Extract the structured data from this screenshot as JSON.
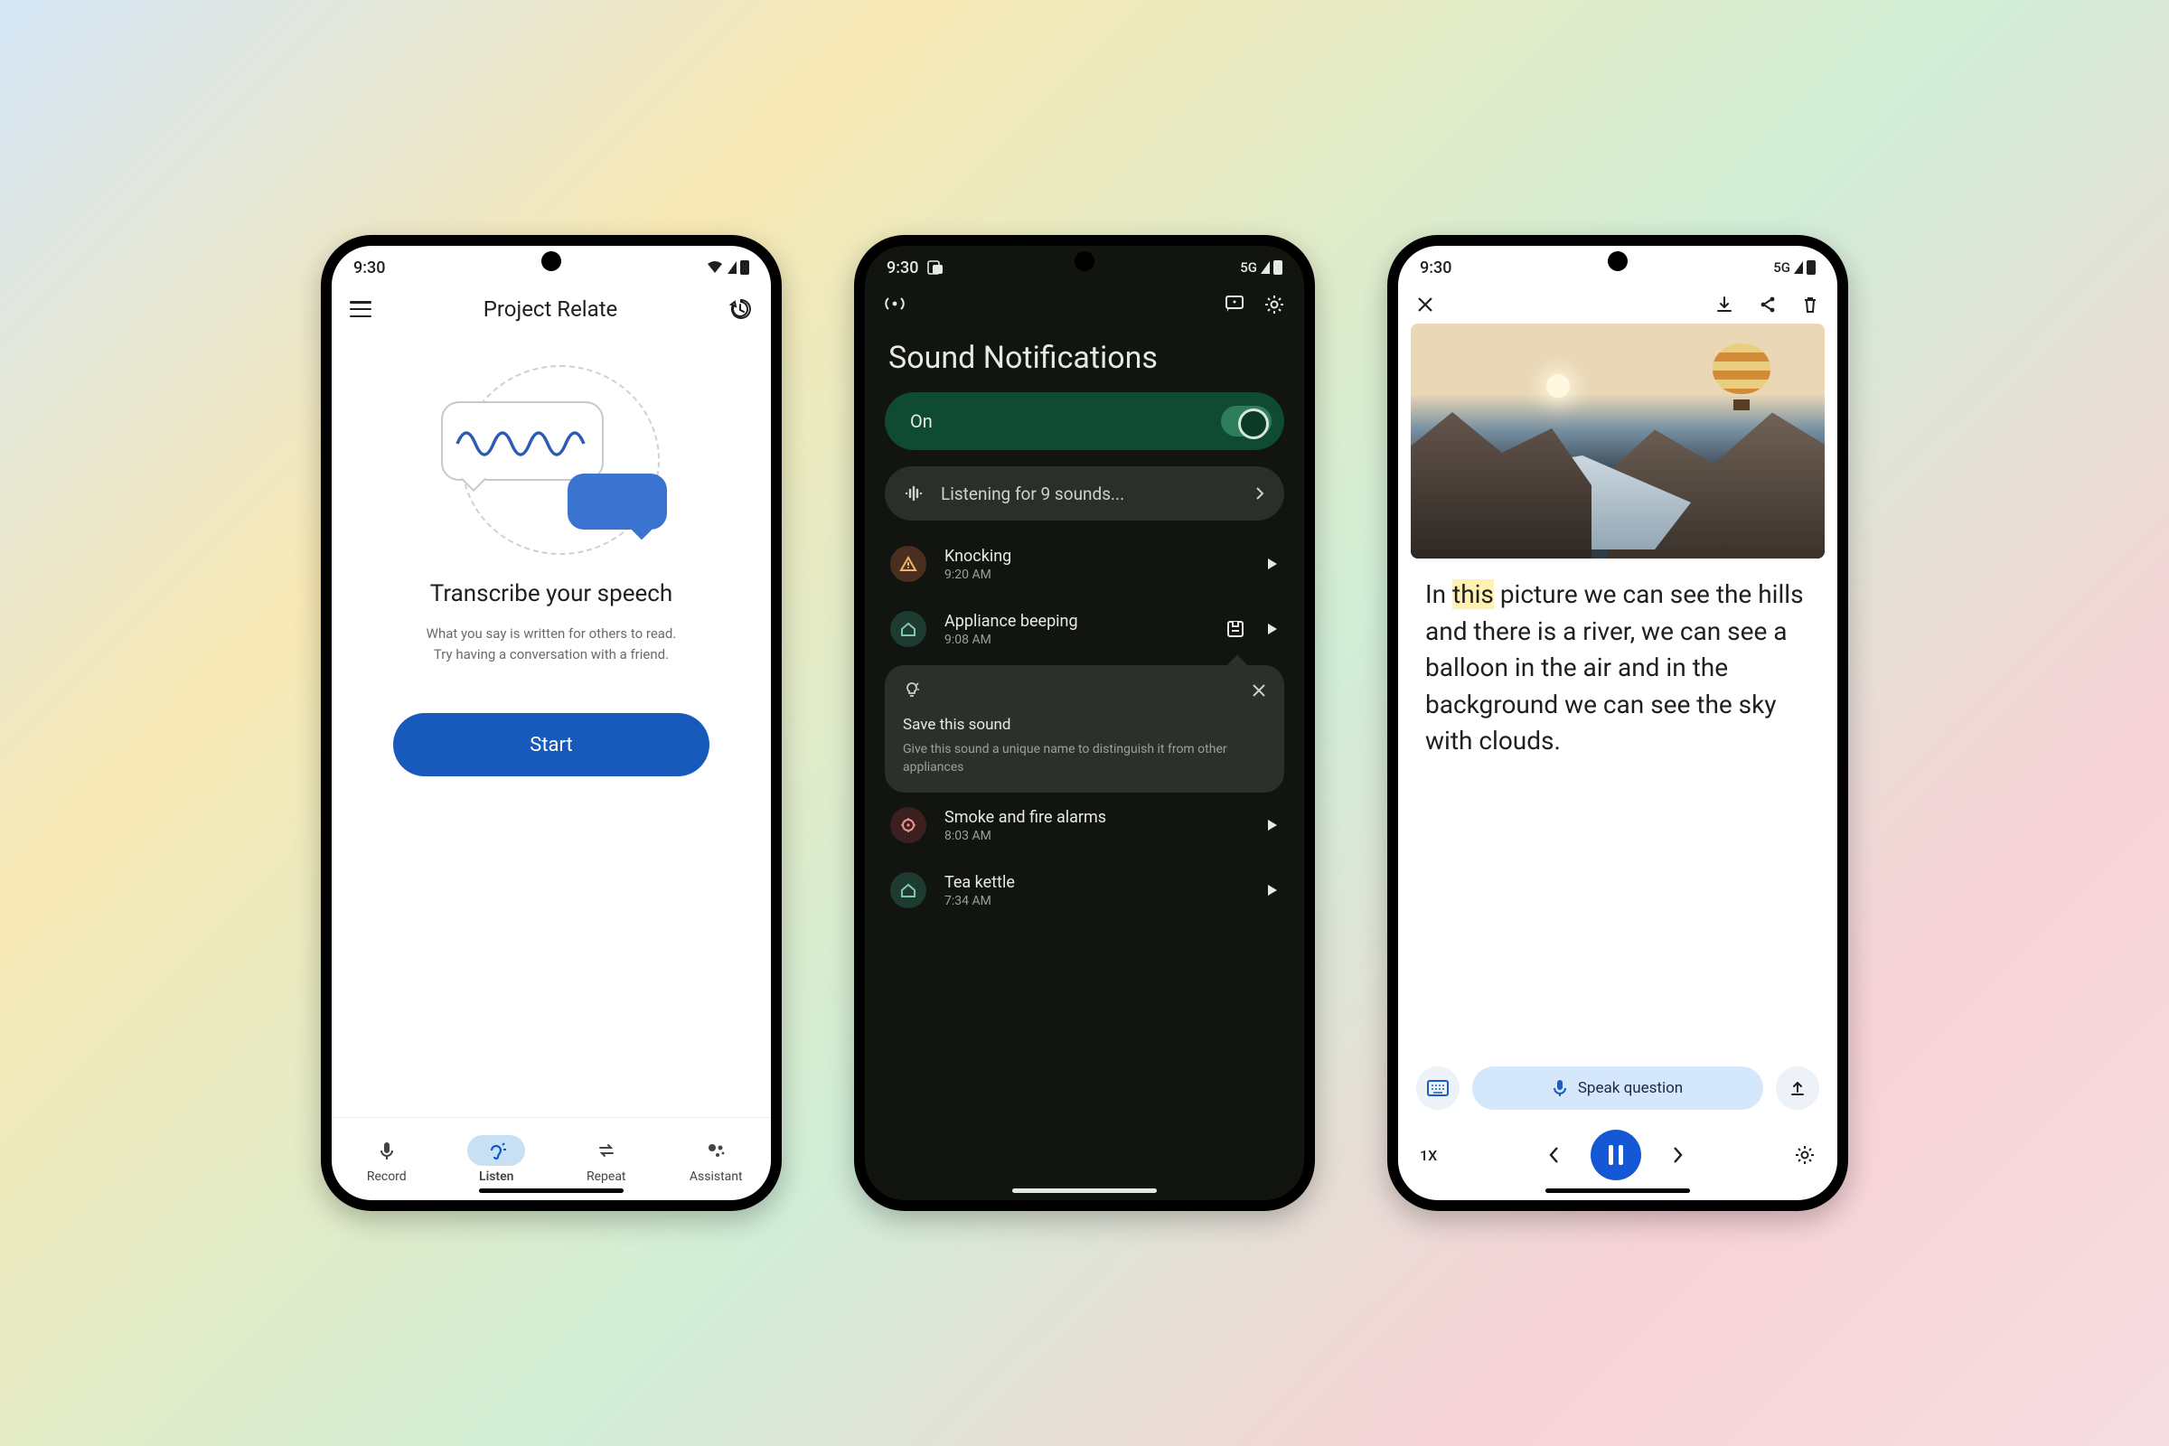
{
  "phone1": {
    "status": {
      "time": "9:30"
    },
    "app_title": "Project Relate",
    "headline": "Transcribe your speech",
    "sub1": "What you say is written for others to read.",
    "sub2": "Try having a conversation with a friend.",
    "start": "Start",
    "nav": {
      "record": "Record",
      "listen": "Listen",
      "repeat": "Repeat",
      "assistant": "Assistant"
    }
  },
  "phone2": {
    "status": {
      "time": "9:30",
      "net": "5G"
    },
    "title": "Sound Notifications",
    "on_label": "On",
    "listening": "Listening for 9 sounds...",
    "sounds": [
      {
        "name": "Knocking",
        "time": "9:20 AM"
      },
      {
        "name": "Appliance beeping",
        "time": "9:08 AM"
      },
      {
        "name": "Smoke and fire alarms",
        "time": "8:03 AM"
      },
      {
        "name": "Tea kettle",
        "time": "7:34 AM"
      }
    ],
    "tip": {
      "title": "Save this sound",
      "body": "Give this sound a unique name to distinguish it from other appliances"
    }
  },
  "phone3": {
    "status": {
      "time": "9:30",
      "net": "5G"
    },
    "caption_pre": "In ",
    "caption_hl": "this",
    "caption_post": " picture we can see the hills and there is a river, we can see a balloon in the air and in the background we can see the sky with clouds.",
    "speak": "Speak question",
    "speed": "1X"
  }
}
